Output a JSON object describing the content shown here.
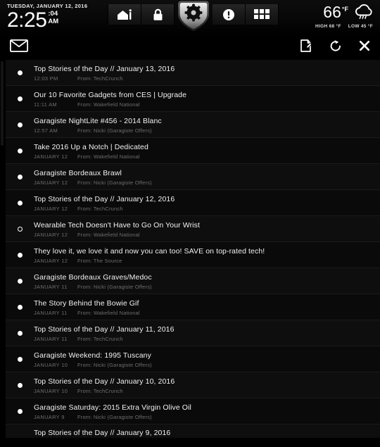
{
  "statusbar": {
    "date": "TUESDAY, JANUARY 12, 2016",
    "time": "2:25",
    "seconds": ":04",
    "ampm": "AM",
    "nav": [
      {
        "name": "garage-icon",
        "label": "Garage"
      },
      {
        "name": "lock-icon",
        "label": "Security"
      },
      {
        "name": "gear-icon",
        "label": "Settings",
        "active": true
      },
      {
        "name": "alert-icon",
        "label": "Alerts"
      },
      {
        "name": "grid-icon",
        "label": "Apps"
      }
    ],
    "weather": {
      "temp": "66",
      "unit": "°F",
      "high": "HIGH 68 °F",
      "low": "LOW 45 °F",
      "condition_icon": "rain-cloud-icon"
    }
  },
  "toolbar": {
    "mail_icon": "envelope-icon",
    "compose_icon": "compose-icon",
    "refresh_icon": "refresh-icon",
    "close_icon": "close-icon",
    "compose_label": "Compose",
    "refresh_label": "Refresh",
    "close_label": "Close"
  },
  "mail": {
    "messages": [
      {
        "subject": "Top Stories of the Day // January 13, 2016",
        "date": "12:03 PM",
        "from": "From: TechCrunch",
        "unread": true
      },
      {
        "subject": "Our 10 Favorite Gadgets from CES | Upgrade",
        "date": "11:11 AM",
        "from": "From: Wakefield National",
        "unread": true
      },
      {
        "subject": "Garagiste NightLite #456 - 2014 Blanc",
        "date": "12:57 AM",
        "from": "From: Nicki (Garagiste Offers)",
        "unread": true
      },
      {
        "subject": "Take 2016 Up a Notch | Dedicated",
        "date": "JANUARY 12",
        "from": "From: Wakefield National",
        "unread": true
      },
      {
        "subject": "Garagiste Bordeaux Brawl",
        "date": "JANUARY 12",
        "from": "From: Nicki (Garagiste Offers)",
        "unread": true
      },
      {
        "subject": "Top Stories of the Day // January 12, 2016",
        "date": "JANUARY 12",
        "from": "From: TechCrunch",
        "unread": true
      },
      {
        "subject": "Wearable Tech Doesn't Have to Go On Your Wrist",
        "date": "JANUARY 12",
        "from": "From: Wakefield National",
        "unread": false
      },
      {
        "subject": "They love it, we love it and now you can too! SAVE on top-rated tech!",
        "date": "JANUARY 12",
        "from": "From: The Source",
        "unread": true
      },
      {
        "subject": "Garagiste Bordeaux Graves/Medoc",
        "date": "JANUARY 11",
        "from": "From: Nicki (Garagiste Offers)",
        "unread": true
      },
      {
        "subject": "The Story Behind the Bowie Gif",
        "date": "JANUARY 11",
        "from": "From: Wakefield National",
        "unread": true
      },
      {
        "subject": "Top Stories of the Day // January 11, 2016",
        "date": "JANUARY 11",
        "from": "From: TechCrunch",
        "unread": true
      },
      {
        "subject": "Garagiste Weekend: 1995 Tuscany",
        "date": "JANUARY 10",
        "from": "From: Nicki (Garagiste Offers)",
        "unread": true
      },
      {
        "subject": "Top Stories of the Day // January 10, 2016",
        "date": "JANUARY 10",
        "from": "From: TechCrunch",
        "unread": true
      },
      {
        "subject": "Garagiste Saturday: 2015 Extra Virgin Olive Oil",
        "date": "JANUARY 9",
        "from": "From: Nicki (Garagiste Offers)",
        "unread": true
      },
      {
        "subject": "Top Stories of the Day // January 9, 2016",
        "date": "",
        "from": "",
        "unread": true,
        "clipped": true
      }
    ]
  },
  "colors": {
    "background": "#000000",
    "row": "#0e0e0e",
    "row_alt": "#0a0a0a",
    "text_primary": "#f2f2f2",
    "text_secondary": "#6e6e6e",
    "accent": "#ffffff"
  }
}
